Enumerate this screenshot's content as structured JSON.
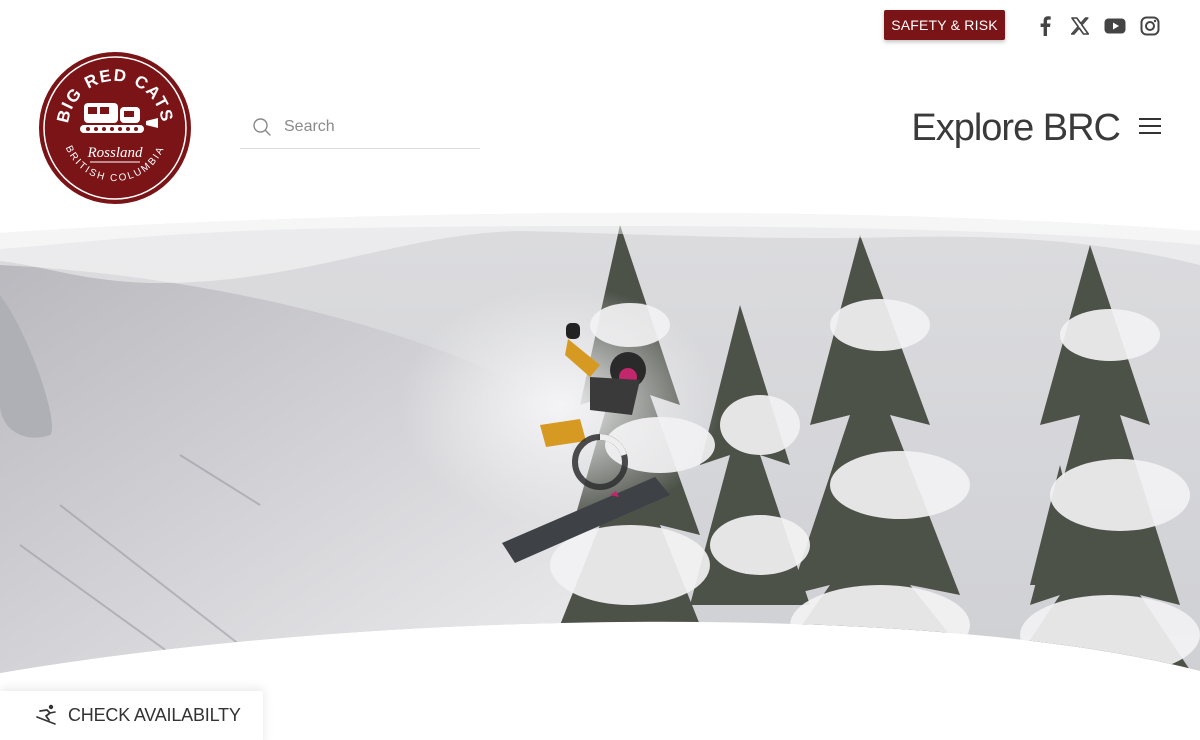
{
  "topbar": {
    "safety_label": "SAFETY & RISK",
    "social": [
      "facebook-icon",
      "x-icon",
      "youtube-icon",
      "instagram-icon"
    ]
  },
  "logo": {
    "top_text": "BIG RED CATS",
    "script_text": "Rossland",
    "bottom_text": "BRITISH COLUMBIA",
    "color": "#7a1417"
  },
  "search": {
    "placeholder": "Search"
  },
  "nav": {
    "explore_label": "Explore BRC"
  },
  "cta": {
    "check_availability": "CHECK AVAILABILTY"
  },
  "colors": {
    "brand": "#7a1417",
    "text": "#333333"
  }
}
